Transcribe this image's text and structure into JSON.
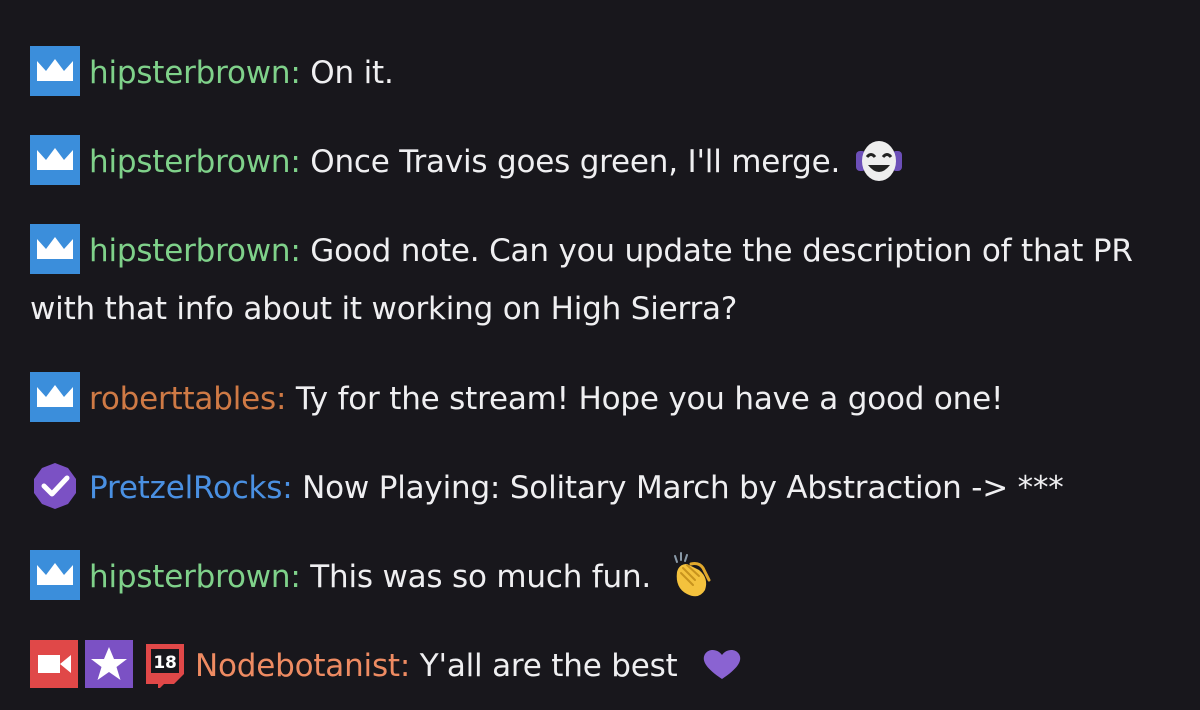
{
  "colors": {
    "background": "#18171c",
    "text": "#efeff1",
    "badge_blue": "#3b8edb",
    "badge_purple": "#7b51c4",
    "badge_red": "#e04848",
    "user_green": "#7fd18a",
    "user_orange": "#cf7a45",
    "user_blue": "#4a90e2",
    "user_salmon": "#ee8b62"
  },
  "messages": [
    {
      "badges": [
        "crown-badge-icon"
      ],
      "username": "hipsterbrown",
      "separator": ":",
      "text": " On it."
    },
    {
      "badges": [
        "crown-badge-icon"
      ],
      "username": "hipsterbrown",
      "separator": ":",
      "text": " Once Travis goes green, I'll merge.",
      "emote": "happy-mask-emote-icon"
    },
    {
      "badges": [
        "crown-badge-icon"
      ],
      "username": "hipsterbrown",
      "separator": ":",
      "text": " Good note. Can you update the description of that PR with that info about it working on High Sierra?"
    },
    {
      "badges": [
        "crown-badge-icon"
      ],
      "username": "roberttables",
      "separator": ":",
      "text": " Ty for the stream! Hope you have a good one!"
    },
    {
      "badges": [
        "verified-bot-badge-icon"
      ],
      "username": "PretzelRocks",
      "separator": ":",
      "text": " Now Playing: Solitary March by Abstraction -> ***"
    },
    {
      "badges": [
        "crown-badge-icon"
      ],
      "username": "hipsterbrown",
      "separator": ":",
      "text": " This was so much fun.",
      "emote": "clapping-hands-emoji-icon"
    },
    {
      "badges": [
        "video-camera-badge-icon",
        "star-badge-icon",
        "age-18-badge-icon"
      ],
      "username": "Nodebotanist",
      "separator": ":",
      "text": " Y'all are the best",
      "emote": "purple-heart-emoji-icon"
    }
  ]
}
